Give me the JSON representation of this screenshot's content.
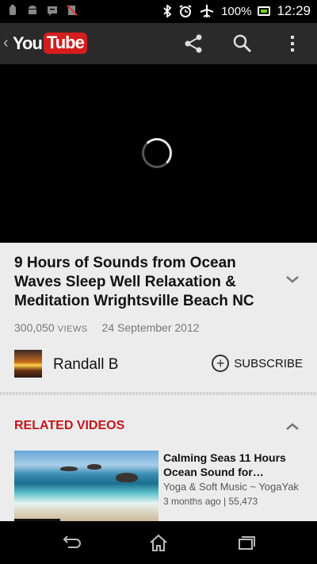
{
  "status_bar": {
    "battery_percent": "100%",
    "time": "12:29",
    "left_icons": [
      "usb-debug-icon",
      "android-icon",
      "message-icon",
      "no-sim-icon"
    ],
    "right_icons": [
      "bluetooth-icon",
      "alarm-icon",
      "airplane-icon",
      "battery-icon"
    ]
  },
  "app_bar": {
    "logo_you": "You",
    "logo_tube": "Tube",
    "actions": [
      "share-icon",
      "search-icon",
      "overflow-menu-icon"
    ]
  },
  "video": {
    "title": "9 Hours of Sounds from Ocean Waves Sleep Well Relaxation & Meditation Wrightsville Beach NC",
    "views": "300,050",
    "views_label": "VIEWS",
    "date": "24 September 2012",
    "channel": "Randall B",
    "subscribe_label": "SUBSCRIBE"
  },
  "related": {
    "header": "RELATED VIDEOS",
    "items": [
      {
        "title": "Calming Seas 11 Hours Ocean Sound for…",
        "channel": "Yoga & Soft Music ~ YogaYak",
        "meta": "3 months ago | 55,473"
      }
    ]
  },
  "colors": {
    "accent_red": "#c4161b",
    "logo_red": "#d51d1d",
    "app_bar": "#2a2a2a",
    "content_bg": "#ececec"
  },
  "nav_bar": [
    "back-icon",
    "home-icon",
    "recent-apps-icon"
  ]
}
